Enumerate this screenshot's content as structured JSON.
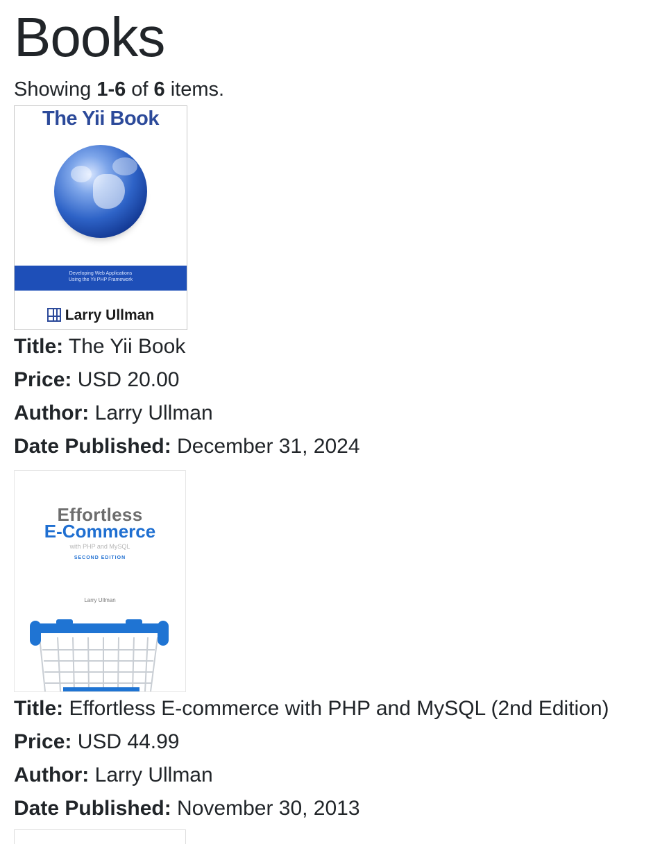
{
  "page": {
    "title": "Books",
    "summary": {
      "prefix": "Showing ",
      "range": "1-6",
      "middle": " of ",
      "total": "6",
      "suffix": " items."
    }
  },
  "labels": {
    "title": "Title:",
    "price": "Price:",
    "author": "Author:",
    "date": "Date Published:"
  },
  "books": [
    {
      "title": "The Yii Book",
      "price": "USD 20.00",
      "author": "Larry Ullman",
      "date": "December 31, 2024",
      "cover": {
        "title": "The Yii Book",
        "band_line1": "Developing Web Applications",
        "band_line2": "Using the Yii PHP Framework",
        "author": "Larry Ullman",
        "colors": {
          "title": "#2c4a9a",
          "band": "#1e4fb8"
        }
      }
    },
    {
      "title": "Effortless E-commerce with PHP and MySQL (2nd Edition)",
      "price": "USD 44.99",
      "author": "Larry Ullman",
      "date": "November 30, 2013",
      "cover": {
        "line1": "Effortless",
        "line2": "E-Commerce",
        "line3": "with PHP and MySQL",
        "edition": "SECOND EDITION",
        "author": "Larry Ullman",
        "colors": {
          "accent": "#1f6fd1",
          "gray": "#6d6d6d"
        }
      }
    }
  ]
}
